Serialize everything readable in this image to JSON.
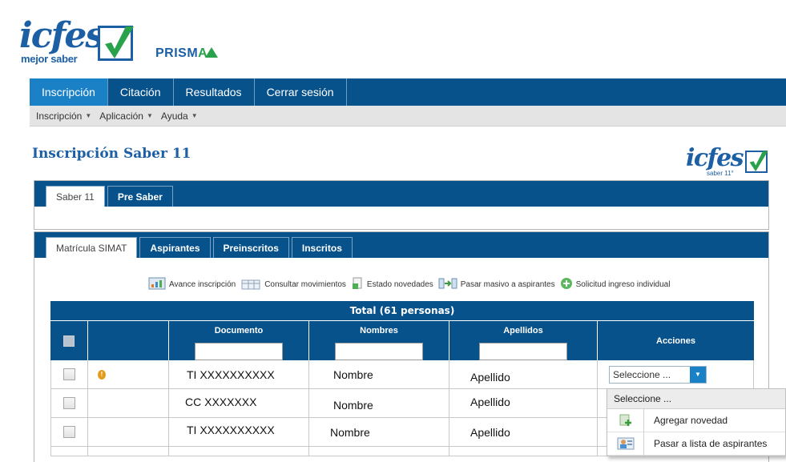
{
  "header": {
    "logo_text": "icfes",
    "logo_sub": "mejor saber",
    "product_name": "PRISMA",
    "product_prefix": "PRISM",
    "product_suffix": "A",
    "secondary_logo_text": "icfes",
    "secondary_logo_sub": "saber 11°"
  },
  "main_nav": [
    {
      "label": "Inscripción",
      "active": true
    },
    {
      "label": "Citación",
      "active": false
    },
    {
      "label": "Resultados",
      "active": false
    },
    {
      "label": "Cerrar sesión",
      "active": false
    }
  ],
  "sub_nav": [
    {
      "label": "Inscripción"
    },
    {
      "label": "Aplicación"
    },
    {
      "label": "Ayuda"
    }
  ],
  "page_title": "Inscripción Saber 11",
  "outer_tabs": [
    {
      "label": "Saber 11",
      "active": true
    },
    {
      "label": "Pre Saber",
      "active": false
    }
  ],
  "inner_tabs": [
    {
      "label": "Matrícula SIMAT",
      "active": true
    },
    {
      "label": "Aspirantes",
      "active": false
    },
    {
      "label": "Preinscritos",
      "active": false
    },
    {
      "label": "Inscritos",
      "active": false
    }
  ],
  "toolbar": [
    {
      "label": "Avance inscripción",
      "icon": "chart-icon"
    },
    {
      "label": "Consultar movimientos",
      "icon": "table-icon"
    },
    {
      "label": "Estado novedades",
      "icon": "document-icon"
    },
    {
      "label": "Pasar masivo a aspirantes",
      "icon": "transfer-icon"
    },
    {
      "label": "Solicitud ingreso individual",
      "icon": "add-circle-icon"
    }
  ],
  "table": {
    "total_label": "Total (61 personas)",
    "columns": {
      "documento": "Documento",
      "nombres": "Nombres",
      "apellidos": "Apellidos",
      "acciones": "Acciones"
    },
    "filters": {
      "documento": "",
      "nombres": "",
      "apellidos": ""
    },
    "rows": [
      {
        "documento": "TI XXXXXXXXXX",
        "nombre": "Nombre",
        "apellido": "Apellido",
        "warning": true,
        "accion": "Seleccione ..."
      },
      {
        "documento": "CC XXXXXXX",
        "nombre": "Nombre",
        "apellido": "Apellido",
        "warning": false,
        "accion": ""
      },
      {
        "documento": "TI XXXXXXXXXX",
        "nombre": "Nombre",
        "apellido": "Apellido",
        "warning": false,
        "accion": ""
      }
    ]
  },
  "dropdown": {
    "header": "Seleccione ...",
    "options": [
      {
        "label": "Agregar novedad",
        "icon": "add-document-icon"
      },
      {
        "label": "Pasar a lista de aspirantes",
        "icon": "users-icon"
      }
    ]
  },
  "colors": {
    "nav_dark": "#08528c",
    "nav_active": "#1a81c7",
    "brand_blue": "#1c5fa5",
    "brand_green": "#2aa14b"
  }
}
